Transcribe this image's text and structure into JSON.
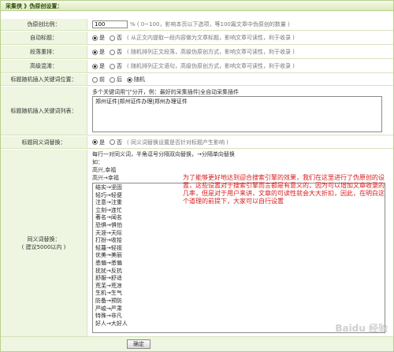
{
  "header": {
    "title": "采集侠 》伪原创设置："
  },
  "rows": {
    "ratio": {
      "label": "伪原创比例：",
      "value": "100",
      "hint": "% ( 0~100，影响本页以下选项，等100篇文章中伪原创的数量 )"
    },
    "auto_title": {
      "label": "自动标题：",
      "yes": "是",
      "no": "否",
      "hint": "( 从正文内提取一段内容做为文章标题，影响文章可读性，利于收录 )"
    },
    "para_shuffle": {
      "label": "段落重排：",
      "yes": "是",
      "no": "否",
      "hint": "( 随机排列正文段落，高级伪原创方式，影响文章可读性，利于收录 )"
    },
    "sentence_shuffle": {
      "label": "高级混淆：",
      "yes": "是",
      "no": "否",
      "hint": "( 随机排列正文语句，高级伪原创方式，影响文章可读性，利于收录 )"
    },
    "title_keyword_pos": {
      "label": "标题随机插入关键词位置：",
      "front": "前",
      "back": "后",
      "random": "随机"
    },
    "keyword_list": {
      "label": "标题随机插入关键词列表：",
      "hint": "多个关键词用\"|\"分开，例：最好的采集插件|全自动采集插件",
      "value": "郑州证件|郑州证件办理|郑州办理证件"
    },
    "synonym_title": {
      "label": "标题同义词替换：",
      "yes": "是",
      "no": "否",
      "hint": "( 同义词替换设置是否针对标题产生影响 )"
    },
    "synonym": {
      "label": "同义词替换：",
      "sublabel": "( 建议5000以内 )",
      "hint_line1": "每行一对同义词，半角逗号分隔双向替换，→分隔单向替换",
      "hint_line2": "如：",
      "example1": "高兴,幸福",
      "example2": "高兴→幸福",
      "value": "结实→坚固\n轻巧→轻便\n注意→注重\n立刻→连忙\n著名→闻名\n恐惧→惧怕\n天涯→天际\n打扮→收拾\n轻蔑→轻视\n优美→美丽\n悉偏→悉偏\n抚扰→反抗\n舒服→舒适\n荒芜→荒凉\n生机→生气\n防备→预防\n严峻→严肃\n特殊→非凡\n好人→大好人"
    }
  },
  "footer": {
    "submit_label": "确定"
  },
  "annotation": "为了能够更好地达到迎合搜索引擎的效果，我们在这里进行了伪原创的设置，这些设置对于搜索引擎而言都是有意义的，因为可以增加文章收录的几率，但是对于用户来讲，文章的可读性就会大大折扣，因此，在明白这个道理的前提下，大家可以自行设置",
  "watermark": "Baidu 经验"
}
